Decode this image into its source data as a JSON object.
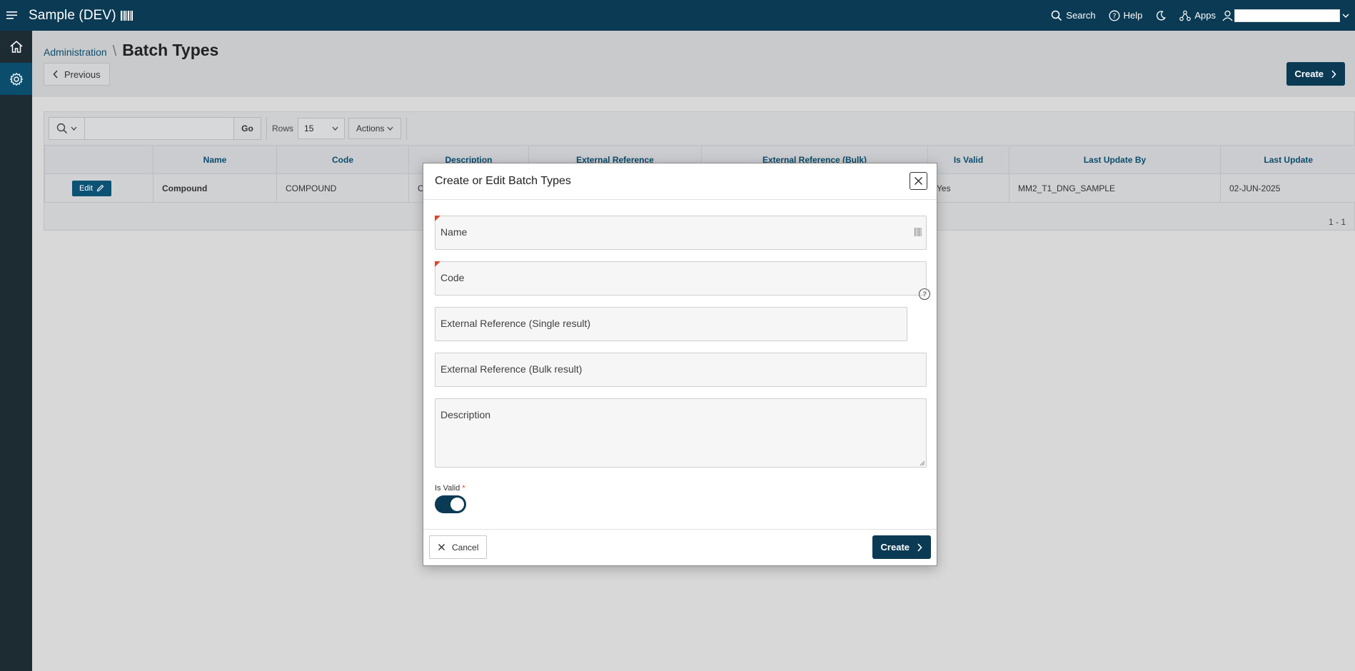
{
  "header": {
    "app_title": "Sample (DEV)",
    "search_label": "Search",
    "help_label": "Help",
    "apps_label": "Apps"
  },
  "nav": {
    "items": [
      "home-icon",
      "gear-icon"
    ]
  },
  "page": {
    "breadcrumb_parent": "Administration",
    "breadcrumb_separator": "\\",
    "title": "Batch Types",
    "previous_label": "Previous",
    "create_label": "Create"
  },
  "report": {
    "go_label": "Go",
    "rows_label": "Rows",
    "rows_value": "15",
    "actions_label": "Actions",
    "columns": [
      "Name",
      "Code",
      "Description",
      "External Reference",
      "External Reference (Bulk)",
      "Is Valid",
      "Last Update By",
      "Last Update"
    ],
    "rows": [
      {
        "edit_label": "Edit",
        "name": "Compound",
        "code": "COMPOUND",
        "description": "C",
        "external_reference": "",
        "external_reference_bulk": "",
        "is_valid": "Yes",
        "last_update_by": "MM2_T1_DNG_SAMPLE",
        "last_update": "02-JUN-2025"
      }
    ],
    "pagination": "1 - 1"
  },
  "dialog": {
    "title": "Create or Edit Batch Types",
    "fields": {
      "name": "Name",
      "code": "Code",
      "ext_single": "External Reference (Single result)",
      "ext_bulk": "External Reference (Bulk result)",
      "description": "Description"
    },
    "is_valid_label": "Is Valid",
    "is_valid_required": "*",
    "is_valid_on": true,
    "cancel_label": "Cancel",
    "create_label": "Create"
  },
  "colors": {
    "header_bg": "#0b3a55",
    "nav_bg": "#1d2b33",
    "primary": "#0b3a55",
    "link": "#0b4d6d",
    "required": "#e0442c"
  }
}
